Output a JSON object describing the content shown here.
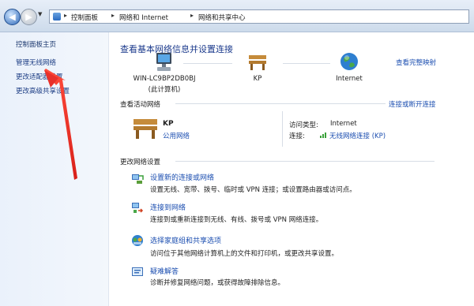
{
  "address_bar": {
    "breadcrumbs": [
      "控制面板",
      "网络和 Internet",
      "网络和共享中心"
    ]
  },
  "sidebar": {
    "home": "控制面板主页",
    "items": [
      "管理无线网络",
      "更改适配器设置",
      "更改高级共享设置"
    ]
  },
  "main": {
    "title": "查看基本网络信息并设置连接",
    "view_full_map": "查看完整映射",
    "map": {
      "computer": "WIN-LC9BP2DB0BJ",
      "computer_sub": "(此计算机)",
      "network": "KP",
      "internet": "Internet"
    },
    "active_networks": {
      "heading": "查看活动网络",
      "connect_disconnect": "连接或断开连接",
      "network_name": "KP",
      "network_type": "公用网络",
      "access_type_label": "访问类型:",
      "access_type_value": "Internet",
      "connection_label": "连接:",
      "connection_value": "无线网络连接 (KP)"
    },
    "change_settings": {
      "heading": "更改网络设置",
      "tasks": [
        {
          "title": "设置新的连接或网络",
          "desc": "设置无线、宽带、拨号、临时或 VPN 连接；或设置路由器或访问点。"
        },
        {
          "title": "连接到网络",
          "desc": "连接到或重新连接到无线、有线、拨号或 VPN 网络连接。"
        },
        {
          "title": "选择家庭组和共享选项",
          "desc": "访问位于其他网络计算机上的文件和打印机，或更改共享设置。"
        },
        {
          "title": "疑难解答",
          "desc": "诊断并修复网络问题，或获得故障排除信息。"
        }
      ]
    }
  },
  "colors": {
    "link": "#1b4eb0",
    "heading": "#1b3a8c",
    "annotation_arrow": "#e8302a"
  },
  "icons": {
    "back": "back-arrow-icon",
    "forward": "forward-arrow-icon",
    "computer": "computer-icon",
    "network": "bench-network-icon",
    "internet": "globe-icon",
    "signal": "wifi-signal-icon"
  }
}
